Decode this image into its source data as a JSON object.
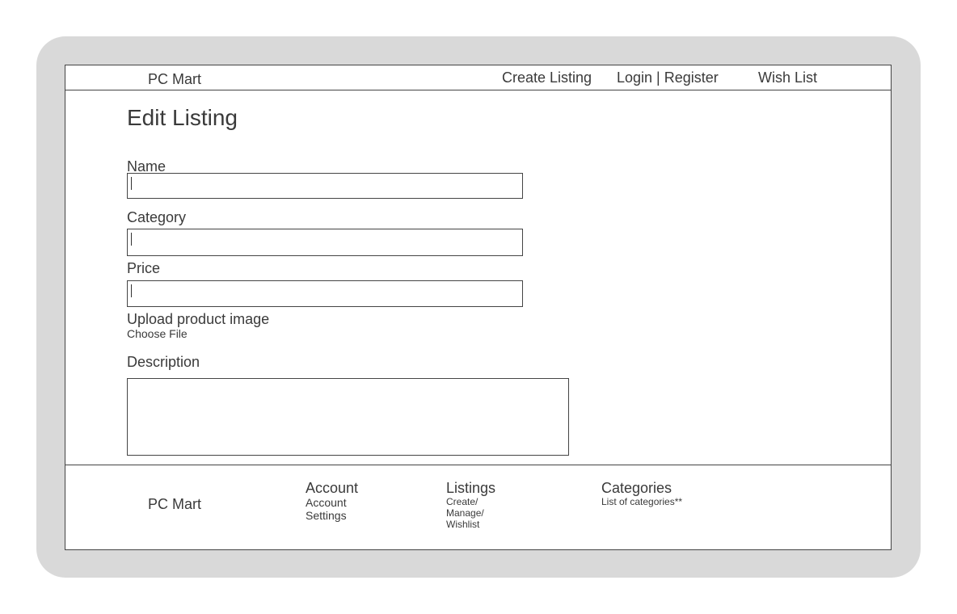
{
  "header": {
    "brand": "PC Mart",
    "create_listing": "Create Listing",
    "login_register": "Login | Register",
    "wish_list": "Wish List"
  },
  "form": {
    "title": "Edit Listing",
    "name_label": "Name",
    "name_value": "",
    "category_label": "Category",
    "category_value": "",
    "price_label": "Price",
    "price_value": "",
    "upload_label": "Upload product image",
    "choose_file": "Choose File",
    "description_label": "Description",
    "description_value": ""
  },
  "footer": {
    "brand": "PC Mart",
    "account_heading": "Account",
    "account_settings": "Account Settings",
    "listings_heading": "Listings",
    "listings_links": "Create/ Manage/ Wishlist",
    "categories_heading": "Categories",
    "categories_text": "List of categories**"
  }
}
